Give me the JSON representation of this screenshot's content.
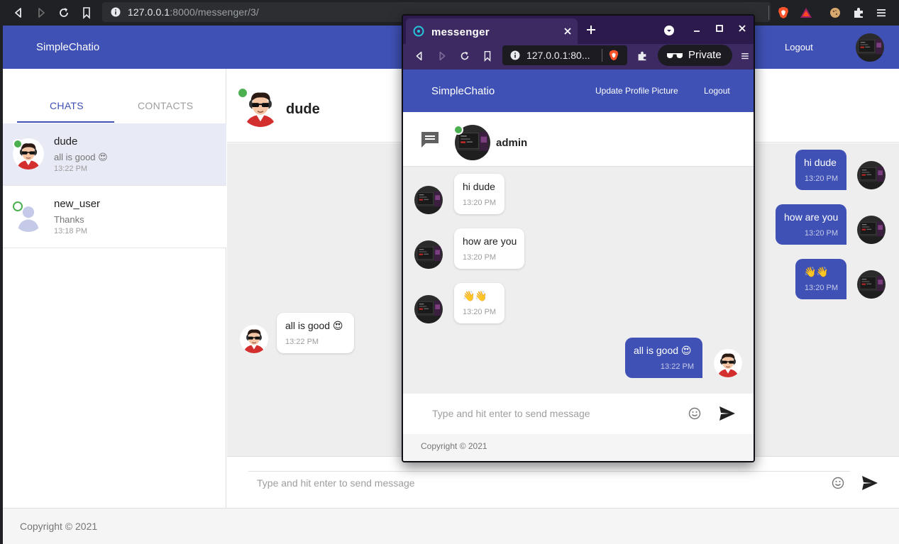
{
  "main_browser": {
    "url_host": "127.0.0.1",
    "url_path": ":8000/messenger/3/"
  },
  "main_page": {
    "brand": "SimpleChatio",
    "logout": "Logout",
    "tabs": [
      "CHATS",
      "CONTACTS"
    ],
    "chats": [
      {
        "name": "dude",
        "message": "all is good 😍",
        "time": "13:22 PM",
        "online": true
      },
      {
        "name": "new_user",
        "message": "Thanks",
        "time": "13:18 PM",
        "online": true
      }
    ],
    "active_chat": {
      "name": "dude"
    },
    "messages": [
      {
        "direction": "out",
        "text": "hi dude",
        "time": "13:20 PM"
      },
      {
        "direction": "out",
        "text": "how are you",
        "time": "13:20 PM"
      },
      {
        "direction": "out",
        "text": "👋👋",
        "time": "13:20 PM"
      },
      {
        "direction": "in",
        "text": "all is good 😍",
        "time": "13:22 PM"
      }
    ],
    "composer_placeholder": "Type and hit enter to send message",
    "copyright": "Copyright © 2021"
  },
  "popup_window": {
    "tab_title": "messenger",
    "url": "127.0.0.1:80...",
    "private_label": "Private",
    "brand": "SimpleChatio",
    "update_profile": "Update Profile Picture",
    "logout": "Logout",
    "active_chat": {
      "name": "admin"
    },
    "messages": [
      {
        "direction": "in",
        "text": "hi dude",
        "time": "13:20 PM"
      },
      {
        "direction": "in",
        "text": "how are you",
        "time": "13:20 PM"
      },
      {
        "direction": "in",
        "text": "👋👋",
        "time": "13:20 PM"
      },
      {
        "direction": "out",
        "text": "all is good 😍",
        "time": "13:22 PM"
      }
    ],
    "composer_placeholder": "Type and hit enter to send message",
    "copyright": "Copyright © 2021"
  },
  "colors": {
    "primary": "#3f51b5",
    "online": "#4caf50",
    "chat_background": "#eeeeee",
    "private_window": "#3d2a63"
  }
}
